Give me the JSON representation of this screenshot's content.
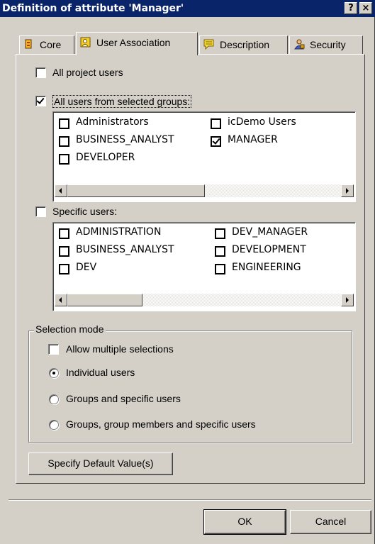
{
  "window": {
    "title": "Definition of attribute 'Manager'",
    "help_button": "?",
    "close_button": "×"
  },
  "tabs": [
    {
      "label": "Core",
      "icon": "core-icon"
    },
    {
      "label": "User Association",
      "icon": "user-association-icon"
    },
    {
      "label": "Description",
      "icon": "description-icon"
    },
    {
      "label": "Security",
      "icon": "security-icon"
    }
  ],
  "active_tab": "User Association",
  "all_project_users": {
    "label": "All project users",
    "checked": false
  },
  "all_users_groups": {
    "label": "All users from selected groups:",
    "checked": true,
    "groups": [
      {
        "label": "Administrators",
        "checked": false
      },
      {
        "label": "icDemo Users",
        "checked": false
      },
      {
        "label": "BUSINESS_ANALYST",
        "checked": false
      },
      {
        "label": "MANAGER",
        "checked": true
      },
      {
        "label": "DEVELOPER",
        "checked": false
      }
    ]
  },
  "specific_users": {
    "label": "Specific users:",
    "checked": false,
    "users": [
      {
        "label": "ADMINISTRATION",
        "checked": false
      },
      {
        "label": "DEV_MANAGER",
        "checked": false
      },
      {
        "label": "BUSINESS_ANALYST",
        "checked": false
      },
      {
        "label": "DEVELOPMENT",
        "checked": false
      },
      {
        "label": "DEV",
        "checked": false
      },
      {
        "label": "ENGINEERING",
        "checked": false
      }
    ]
  },
  "selection_mode": {
    "title": "Selection mode",
    "allow_multiple": {
      "label": "Allow multiple selections",
      "checked": false
    },
    "options": [
      {
        "label": "Individual users",
        "selected": true
      },
      {
        "label": "Groups and specific users",
        "selected": false
      },
      {
        "label": "Groups, group members and specific users",
        "selected": false
      }
    ]
  },
  "specify_default_label": "Specify Default Value(s)",
  "footer": {
    "ok_label": "OK",
    "cancel_label": "Cancel"
  }
}
